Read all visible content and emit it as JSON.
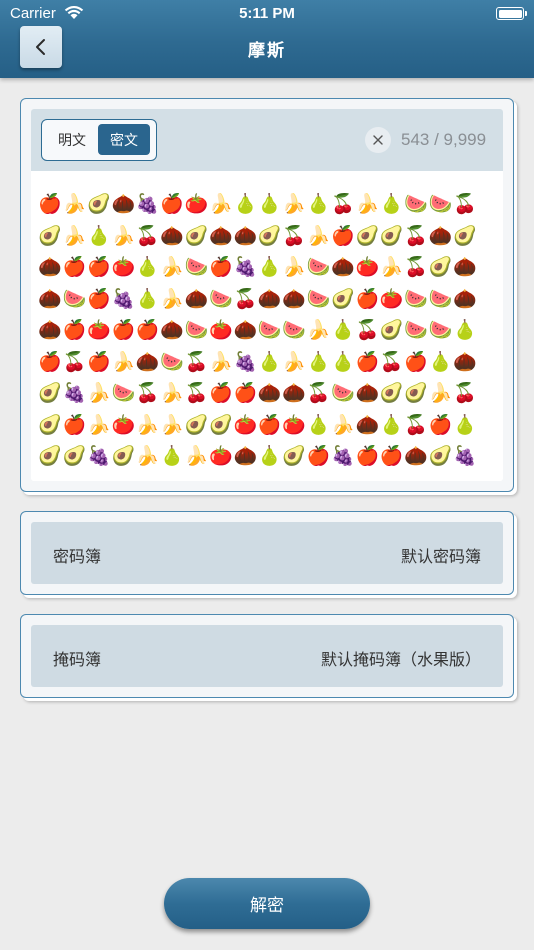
{
  "status_bar": {
    "carrier": "Carrier",
    "time": "5:11 PM"
  },
  "nav": {
    "title": "摩斯",
    "back_icon": "chevron-left-icon"
  },
  "editor": {
    "modes": [
      "明文",
      "密文"
    ],
    "selected_mode": "密文",
    "char_count": "543 / 9,999",
    "clear_icon": "close-icon",
    "content_rows": [
      "🍎🍌🥑🌰🍇🍎🍅🍌🍐🍐🍌🍐🍒🍌🍐🍉🍉🍒",
      "🥑🍌🍐🍌🍒🌰🥑🌰🌰🥑🍒🍌🍎🥑🥑🍒🌰🥑",
      "🌰🍎🍎🍅🍐🍌🍉🍎🍇🍐🍌🍉🌰🍅🍌🍒🥑🌰",
      "🌰🍉🍎🍇🍐🍌🌰🍉🍒🌰🌰🍉🥑🍎🍅🍉🍉🌰",
      "🌰🍎🍅🍎🍎🌰🍉🍅🌰🍉🍉🍌🍐🍒🥑🍉🍉🍐",
      "🍎🍒🍎🍌🌰🍉🍒🍌🍇🍐🍌🍐🍐🍎🍒🍎🍐🌰",
      "🥑🍇🍌🍉🍒🍌🍒🍎🍎🌰🌰🍒🍉🌰🥑🥑🍌🍒",
      "🥑🍎🍌🍅🍌🍌🥑🥑🍅🍎🍅🍐🍌🌰🍐🍒🍎🍐",
      "🥑🥑🍇🥑🍌🍐🍌🍅🌰🍐🥑🍎🍇🍎🍎🌰🥑🍇"
    ]
  },
  "codebook": {
    "label": "密码簿",
    "value": "默认密码簿"
  },
  "maskbook": {
    "label": "掩码簿",
    "value": "默认掩码簿（水果版）"
  },
  "actions": {
    "decrypt_label": "解密"
  },
  "colors": {
    "brand": "#2a658e",
    "header": "#2e6a91",
    "card_border": "#4d89b0",
    "row_bg": "#cfdbe3"
  }
}
